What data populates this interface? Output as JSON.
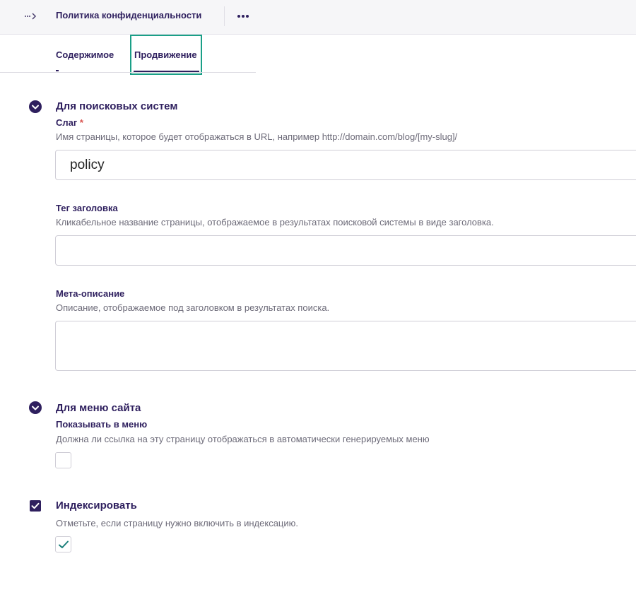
{
  "header": {
    "title": "Политика конфиденциальности"
  },
  "tabs": [
    {
      "label": "Содержимое",
      "active": false
    },
    {
      "label": "Продвижение",
      "active": true
    }
  ],
  "sections": {
    "seo": {
      "title": "Для поисковых систем",
      "icon": "chevron-down-circle-icon",
      "slug": {
        "label": "Слаг",
        "required_mark": "*",
        "help": "Имя страницы, которое будет отображаться в URL, например http://domain.com/blog/[my-slug]/",
        "value": "policy"
      },
      "title_tag": {
        "label": "Тег заголовка",
        "help": "Кликабельное название страницы, отображаемое в результатах поисковой системы в виде заголовка.",
        "value": ""
      },
      "meta_description": {
        "label": "Мета-описание",
        "help": "Описание, отображаемое под заголовком в результатах поиска.",
        "value": ""
      }
    },
    "menu": {
      "title": "Для меню сайта",
      "icon": "chevron-down-circle-icon",
      "show_in_menu": {
        "label": "Показывать в меню",
        "help": "Должна ли ссылка на эту страницу отображаться в автоматически генерируемых меню",
        "checked": false
      }
    },
    "indexing": {
      "title": "Индексировать",
      "icon": "checkbox-checked-icon",
      "help": "Отметьте, если страницу нужно включить в индексацию.",
      "checked": true
    }
  },
  "colors": {
    "primary": "#2e1f5e",
    "focus": "#1a9f87",
    "required": "#d9534f",
    "check": "#1a7f7a"
  }
}
